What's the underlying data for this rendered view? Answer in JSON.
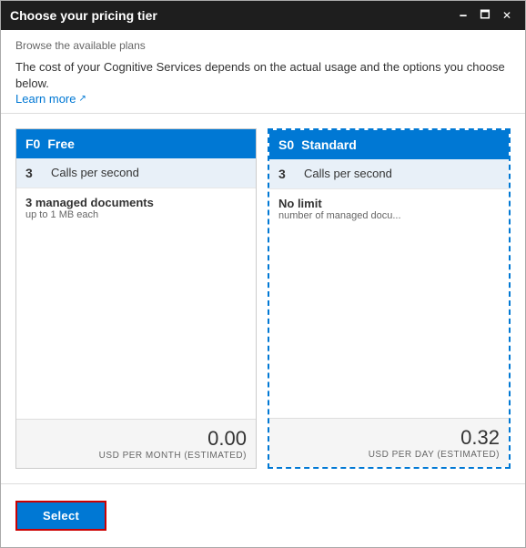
{
  "window": {
    "title": "Choose your pricing tier",
    "subtitle": "Browse the available plans"
  },
  "header": {
    "info_text": "The cost of your Cognitive Services depends on the actual usage and the options you choose below.",
    "learn_more_label": "Learn more",
    "learn_more_url": "#"
  },
  "plans": [
    {
      "id": "f0",
      "code": "F0",
      "name": "Free",
      "selected": false,
      "feature_value": "3",
      "feature_label": "Calls per second",
      "detail_value": "3 managed documents",
      "detail_sub": "up to 1 MB each",
      "price_amount": "0.00",
      "price_unit": "USD PER MONTH (ESTIMATED)"
    },
    {
      "id": "s0",
      "code": "S0",
      "name": "Standard",
      "selected": true,
      "feature_value": "3",
      "feature_label": "Calls per second",
      "detail_value": "No limit",
      "detail_sub": "number of managed docu...",
      "price_amount": "0.32",
      "price_unit": "USD PER DAY (ESTIMATED)"
    }
  ],
  "footer": {
    "select_label": "Select"
  },
  "controls": {
    "minimize": "🗕",
    "maximize": "🗖",
    "close": "✕"
  }
}
